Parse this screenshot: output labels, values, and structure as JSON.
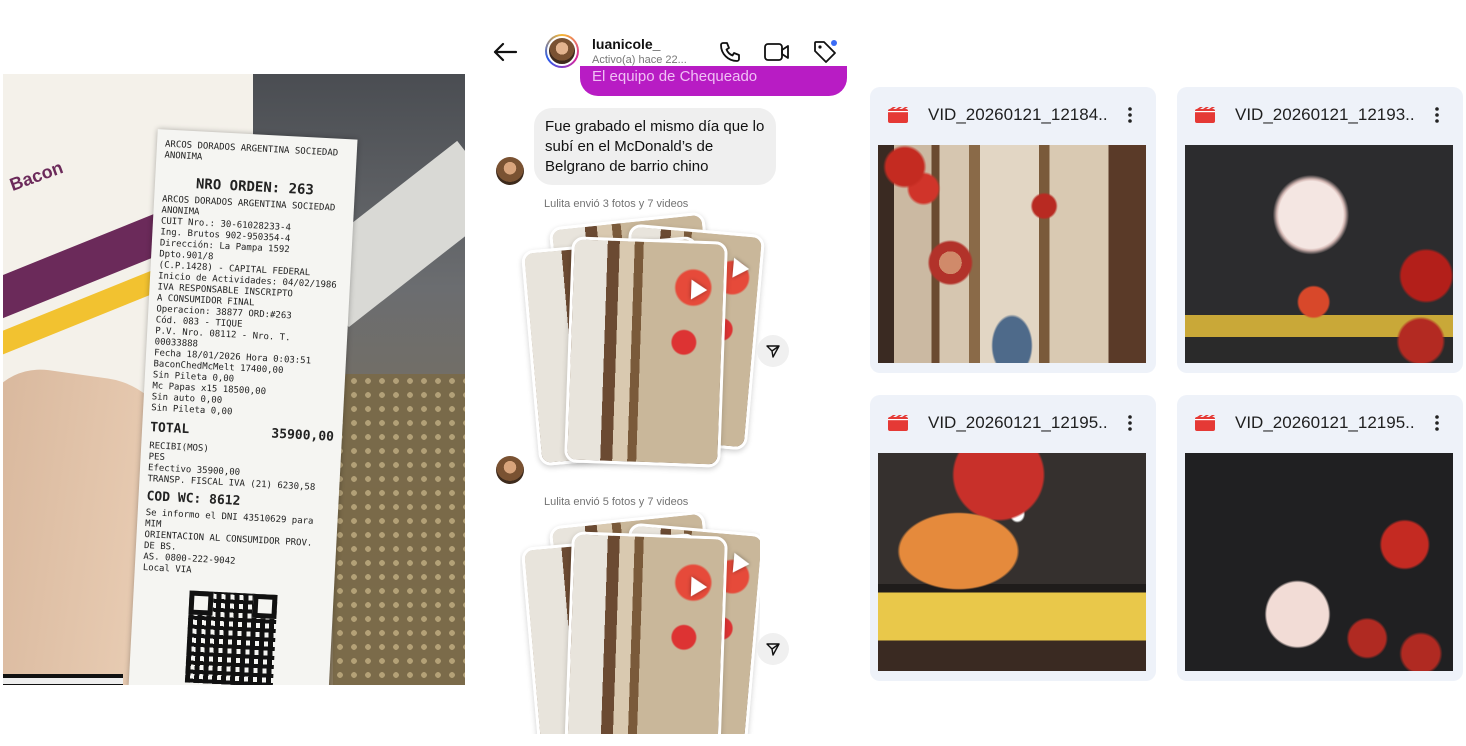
{
  "chat": {
    "username": "luanicole_",
    "activity": "Activo(a) hace 22...",
    "pink_message_fragment": "El equipo de Chequeado",
    "gray_message": "Fue grabado el mismo día que lo subí en el McDonald’s de Belgrano de barrio chino",
    "sent_note_1": "Lulita envió 3 fotos y 7 videos",
    "sent_note_2": "Lulita envió 5 fotos y 7 videos",
    "accent_color": "#b81cc4"
  },
  "header_icons": [
    "back-arrow-icon",
    "phone-icon",
    "video-camera-icon",
    "tag-icon"
  ],
  "receipt": {
    "header": "ARCOS DORADOS ARGENTINA SOCIEDAD ANONIMA",
    "order_label": "NRO ORDEN:",
    "order_number": "263",
    "lines": [
      "ARCOS DORADOS ARGENTINA SOCIEDAD ANONIMA",
      "CUIT Nro.: 30-61028233-4",
      "Ing. Brutos 902-950354-4",
      "Dirección: La Pampa 1592 Dpto.901/8",
      "(C.P.1428) - CAPITAL FEDERAL",
      "Inicio de Actividades: 04/02/1986",
      "IVA RESPONSABLE INSCRIPTO",
      "A CONSUMIDOR FINAL",
      "Operacion: 38877  ORD:#263",
      "Cód. 083 - TIQUE",
      "P.V. Nro. 08112 - Nro. T. 00033888",
      "Fecha 18/01/2026     Hora 0:03:51",
      "BaconChedMcMelt       17400,00",
      "Sin Pileta               0,00",
      "Mc Papas x15          18500,00",
      "Sin auto                 0,00",
      "Sin Pileta               0,00"
    ],
    "total_label": "TOTAL",
    "total_value": "35900,00",
    "payment_lines": [
      "RECIBI(MOS)",
      "PES",
      "Efectivo            35900,00",
      "TRANSP. FISCAL IVA (21)  6230,58"
    ],
    "cod_wc": "COD WC: 8612",
    "footer_lines": [
      "Se informo el DNI 43510629 para MIM",
      "ORIENTACION AL CONSUMIDOR PROV. DE BS.",
      "AS. 0800-222-9042",
      "Local VIA"
    ],
    "wrapper_brand": "Bacon"
  },
  "videos": [
    {
      "name": "VID_20260121_12184..."
    },
    {
      "name": "VID_20260121_12193..."
    },
    {
      "name": "VID_20260121_12195..."
    },
    {
      "name": "VID_20260121_12195..."
    }
  ]
}
